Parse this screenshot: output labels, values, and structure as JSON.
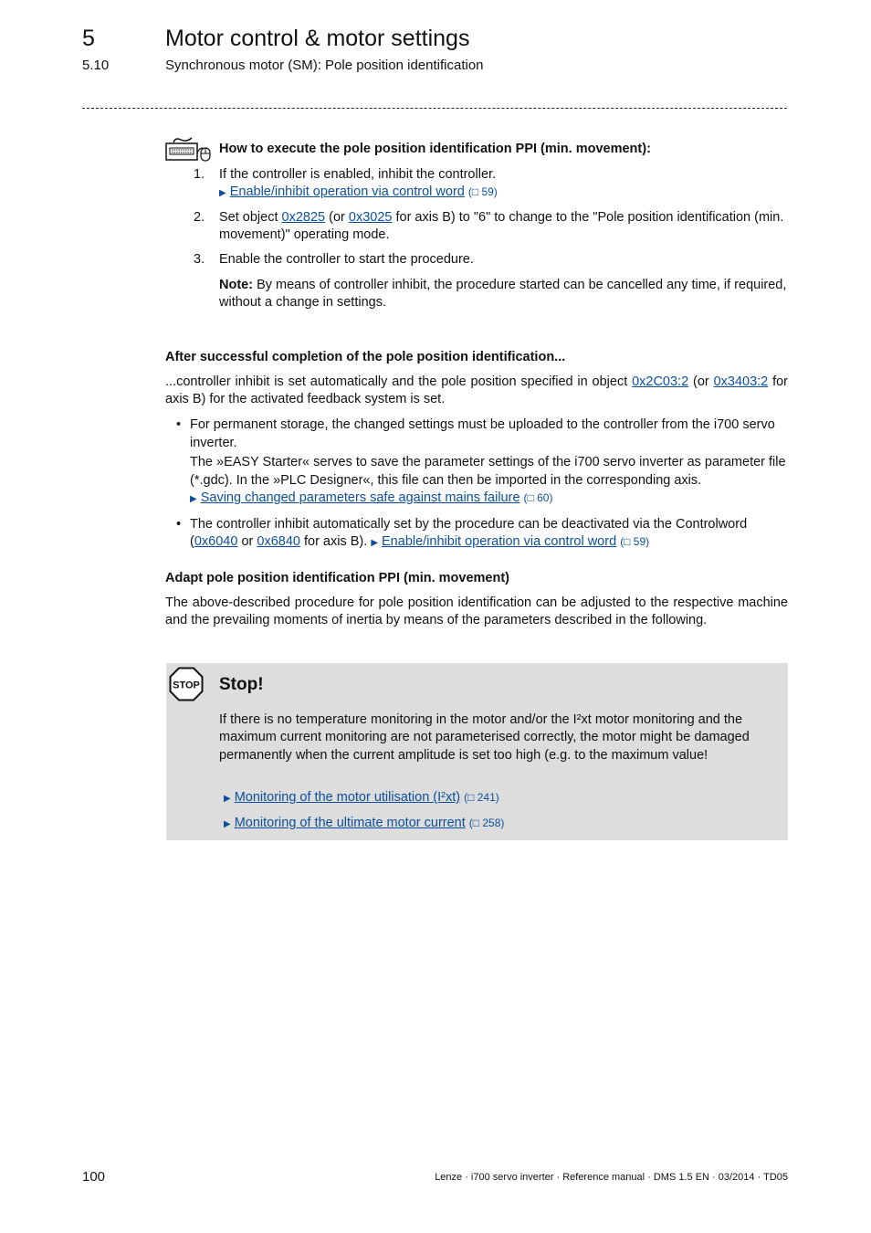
{
  "header": {
    "chapter_number": "5",
    "chapter_title": "Motor control & motor settings",
    "section_number": "5.10",
    "section_title": "Synchronous motor (SM): Pole position identification"
  },
  "procedure": {
    "icon": "keyboard-mouse-icon",
    "heading": "How to execute the pole position identification PPI (min. movement):",
    "steps": [
      {
        "number": "1.",
        "text": "If the controller is enabled, inhibit the controller.",
        "link": {
          "label": "Enable/inhibit operation via control word",
          "page_ref": "(□ 59)"
        }
      },
      {
        "number": "2.",
        "text_before": "Set object ",
        "link1": "0x2825",
        "text_mid": " (or ",
        "link2": "0x3025",
        "text_after": " for axis B) to \"6\" to change to the \"Pole position identification (min. movement)\" operating mode."
      },
      {
        "number": "3.",
        "text": "Enable the controller to start the procedure.",
        "note_label": "Note:",
        "note_text": " By means of controller inhibit, the procedure started can be cancelled any time, if required, without a change in settings."
      }
    ]
  },
  "completion": {
    "heading": "After successful completion of the pole position identification...",
    "para_before": "...controller inhibit is set automatically and the pole position specified in object ",
    "link1": "0x2C03:2",
    "para_mid": " (or ",
    "link2": "0x3403:2",
    "para_after": " for axis B) for the activated feedback system is set.",
    "bullets": [
      {
        "text": "For permanent storage, the changed settings must be uploaded to the controller from the i700 servo inverter.",
        "text2": "The »EASY Starter« serves to save the parameter settings of the i700 servo inverter as parameter file (*.gdc). In the »PLC Designer«, this file can then be imported in the corresponding axis.",
        "link": {
          "label": "Saving changed parameters safe against mains failure",
          "page_ref": "(□ 60)"
        }
      },
      {
        "text_before": "The controller inhibit automatically set by the procedure can be deactivated via the Controlword (",
        "link1": "0x6040",
        "text_mid": " or ",
        "link2": "0x6840",
        "text_after": " for axis B). ",
        "link": {
          "label": "Enable/inhibit operation via control word",
          "page_ref": "(□ 59)"
        }
      }
    ]
  },
  "adapt": {
    "heading": "Adapt pole position identification PPI (min. movement)",
    "paragraph": "The above-described procedure for pole position identification can be adjusted to the respective machine and the prevailing moments of inertia by means of the parameters described in the following."
  },
  "stop_box": {
    "icon": "stop-sign-icon",
    "icon_text": "STOP",
    "title": "Stop!",
    "text": "If there is no temperature monitoring in the motor and/or the I²xt motor monitoring and the maximum current monitoring are not parameterised correctly, the motor might be damaged permanently when the current amplitude is set too high (e.g. to the maximum value!",
    "links": [
      {
        "label": "Monitoring of the motor utilisation (I²xt)",
        "page_ref": "(□ 241)"
      },
      {
        "label": "Monitoring of the ultimate motor current",
        "page_ref": "(□ 258)"
      }
    ],
    "background_color": "#dddddd"
  },
  "footer": {
    "page_number": "100",
    "document_info": "Lenze · i700 servo inverter · Reference manual · DMS 1.5 EN · 03/2014 · TD05"
  },
  "colors": {
    "link": "#0b4f9c",
    "text": "#111111"
  }
}
